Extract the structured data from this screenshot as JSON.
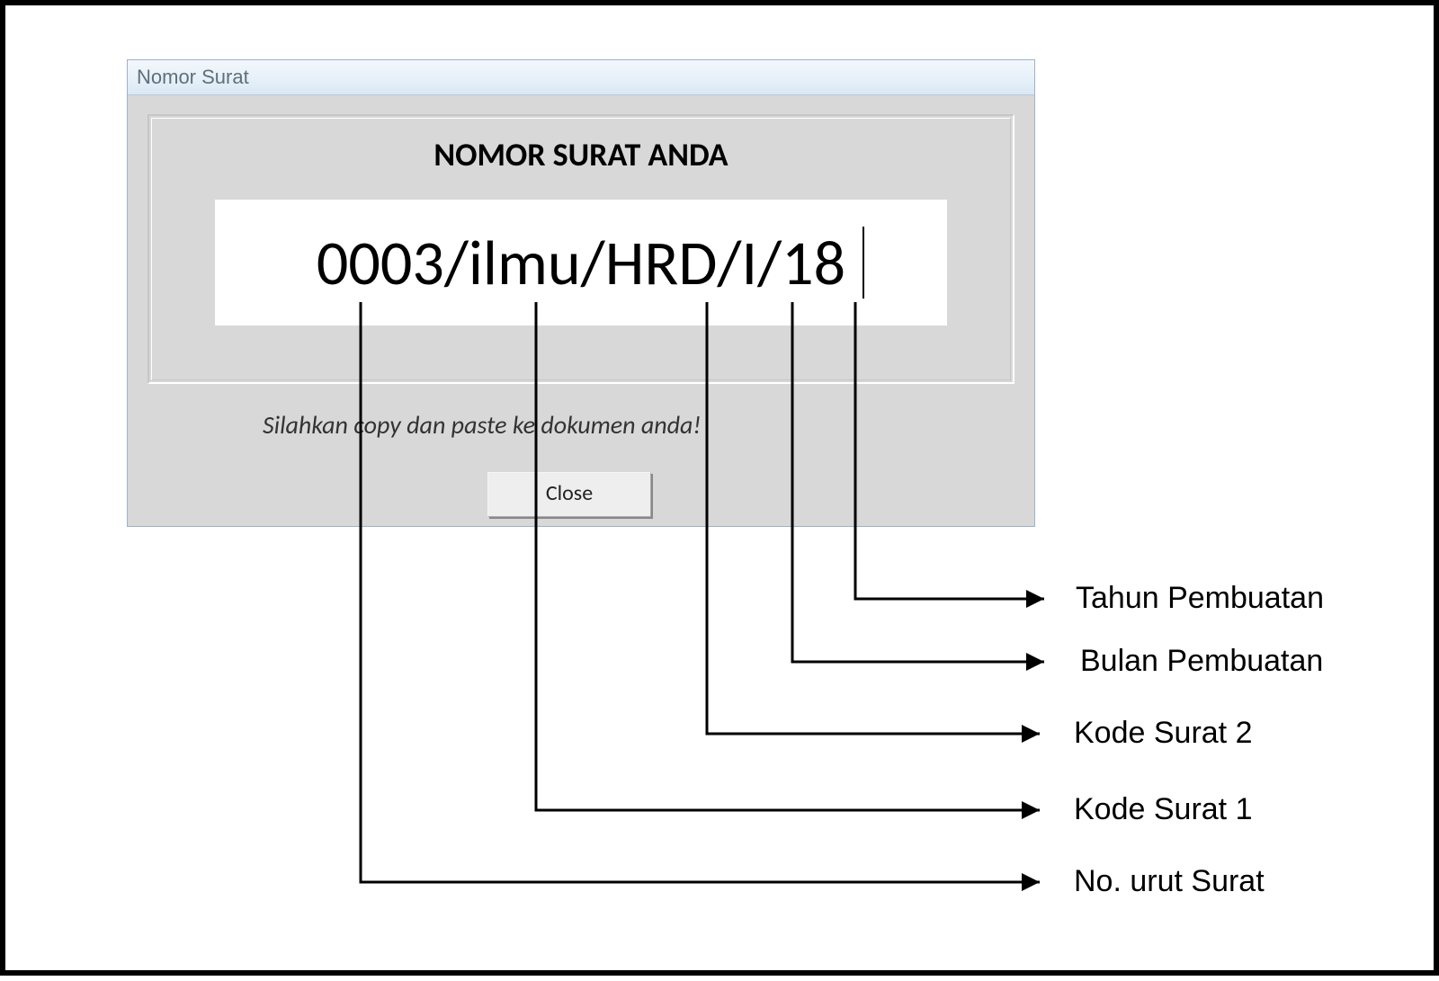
{
  "dialog": {
    "title": "Nomor Surat",
    "heading": "NOMOR SURAT ANDA",
    "value": "0003/ilmu/HRD/I/18",
    "instruction": "Silahkan copy dan paste ke dokumen anda!",
    "close_label": "Close"
  },
  "annotations": {
    "tahun": "Tahun Pembuatan",
    "bulan": "Bulan Pembuatan",
    "kode2": "Kode Surat 2",
    "kode1": "Kode Surat 1",
    "nourut": "No. urut Surat"
  },
  "diagram": {
    "value_segments": [
      {
        "text": "0003",
        "meaning": "No. urut Surat"
      },
      {
        "text": "ilmu",
        "meaning": "Kode Surat 1"
      },
      {
        "text": "HRD",
        "meaning": "Kode Surat 2"
      },
      {
        "text": "I",
        "meaning": "Bulan Pembuatan"
      },
      {
        "text": "18",
        "meaning": "Tahun Pembuatan"
      }
    ],
    "separator": "/"
  }
}
